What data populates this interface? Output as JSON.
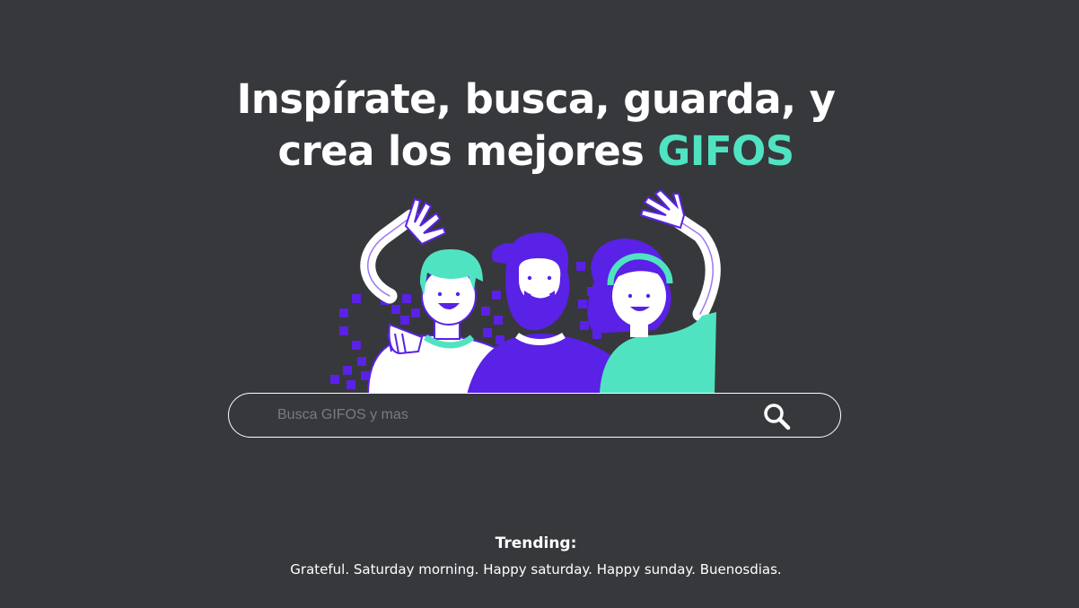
{
  "hero": {
    "title_part1": "Inspírate, busca, guarda, y",
    "title_part2": "crea los mejores",
    "title_accent": "GIFOS"
  },
  "search": {
    "placeholder": "Busca GIFOS y mas",
    "value": "",
    "icon": "search-icon"
  },
  "trending": {
    "label": "Trending:",
    "items": [
      {
        "text": "Grateful"
      },
      {
        "text": "Saturday morning"
      },
      {
        "text": "Happy saturday"
      },
      {
        "text": "Happy sunday"
      },
      {
        "text": "Buenosdias"
      }
    ]
  },
  "colors": {
    "background": "#37383c",
    "accent": "#50e3c2",
    "purple": "#5a21e6",
    "text": "#ffffff"
  }
}
